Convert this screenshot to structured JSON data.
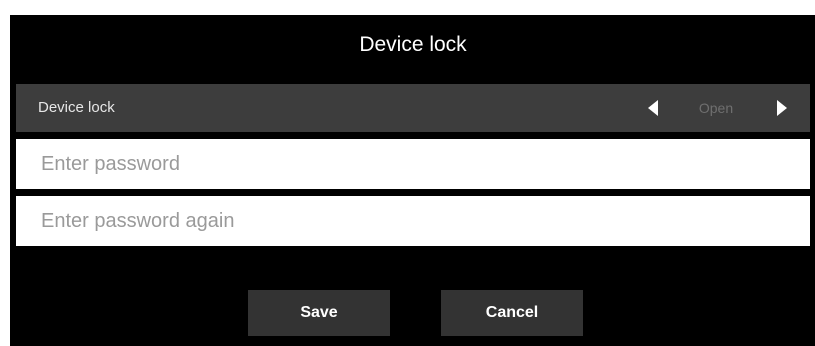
{
  "dialog": {
    "title": "Device lock"
  },
  "setting": {
    "label": "Device lock",
    "value": "Open",
    "prev_icon": "triangle-left-icon",
    "next_icon": "triangle-right-icon"
  },
  "fields": {
    "password_placeholder": "Enter password",
    "confirm_placeholder": "Enter password again",
    "password_value": "",
    "confirm_value": ""
  },
  "buttons": {
    "save_label": "Save",
    "cancel_label": "Cancel"
  },
  "colors": {
    "background": "#000000",
    "row_background": "#3d3d3d",
    "button_background": "#333333",
    "field_background": "#ffffff",
    "value_text": "#6f6f6f"
  }
}
